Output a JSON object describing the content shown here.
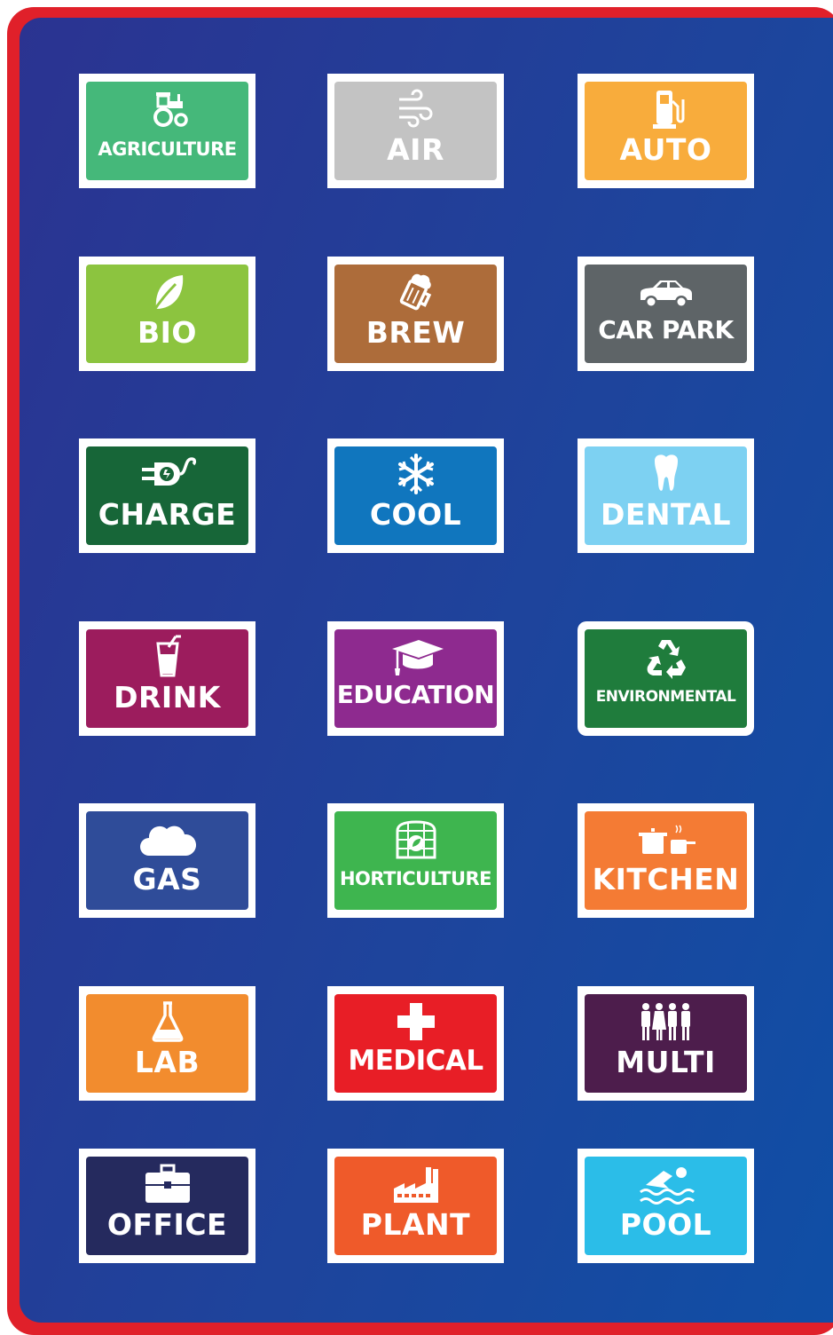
{
  "signs": [
    {
      "label": "AGRICULTURE",
      "icon": "tractor-icon",
      "color": "#45b87a"
    },
    {
      "label": "AIR",
      "icon": "wind-icon",
      "color": "#c3c3c3"
    },
    {
      "label": "AUTO",
      "icon": "fuel-pump-icon",
      "color": "#f8ac3c"
    },
    {
      "label": "BIO",
      "icon": "leaf-icon",
      "color": "#8cc43f"
    },
    {
      "label": "BREW",
      "icon": "beer-mug-icon",
      "color": "#ad6c3a"
    },
    {
      "label": "CAR PARK",
      "icon": "car-icon",
      "color": "#5e6467"
    },
    {
      "label": "CHARGE",
      "icon": "ev-plug-icon",
      "color": "#176638"
    },
    {
      "label": "COOL",
      "icon": "snowflake-icon",
      "color": "#1076be"
    },
    {
      "label": "DENTAL",
      "icon": "tooth-icon",
      "color": "#7dd1f2"
    },
    {
      "label": "DRINK",
      "icon": "drink-cup-icon",
      "color": "#9c1c5d"
    },
    {
      "label": "EDUCATION",
      "icon": "graduation-cap-icon",
      "color": "#8e2a8f"
    },
    {
      "label": "ENVIRONMENTAL",
      "icon": "recycle-icon",
      "color": "#1f7c3c"
    },
    {
      "label": "GAS",
      "icon": "cloud-icon",
      "color": "#2f4c99"
    },
    {
      "label": "HORTICULTURE",
      "icon": "greenhouse-icon",
      "color": "#3eb54f"
    },
    {
      "label": "KITCHEN",
      "icon": "cooking-pots-icon",
      "color": "#f47b34"
    },
    {
      "label": "LAB",
      "icon": "flask-icon",
      "color": "#f28c2e"
    },
    {
      "label": "MEDICAL",
      "icon": "medical-cross-icon",
      "color": "#e81e26"
    },
    {
      "label": "MULTI",
      "icon": "people-icon",
      "color": "#4d1d4c"
    },
    {
      "label": "OFFICE",
      "icon": "briefcase-icon",
      "color": "#252a5e"
    },
    {
      "label": "PLANT",
      "icon": "factory-icon",
      "color": "#ef5a2a"
    },
    {
      "label": "POOL",
      "icon": "swimmer-icon",
      "color": "#2bbde8"
    }
  ],
  "colors": {
    "frame": "#e0202a",
    "panel": "#233b96",
    "tile_border": "#ffffff"
  }
}
